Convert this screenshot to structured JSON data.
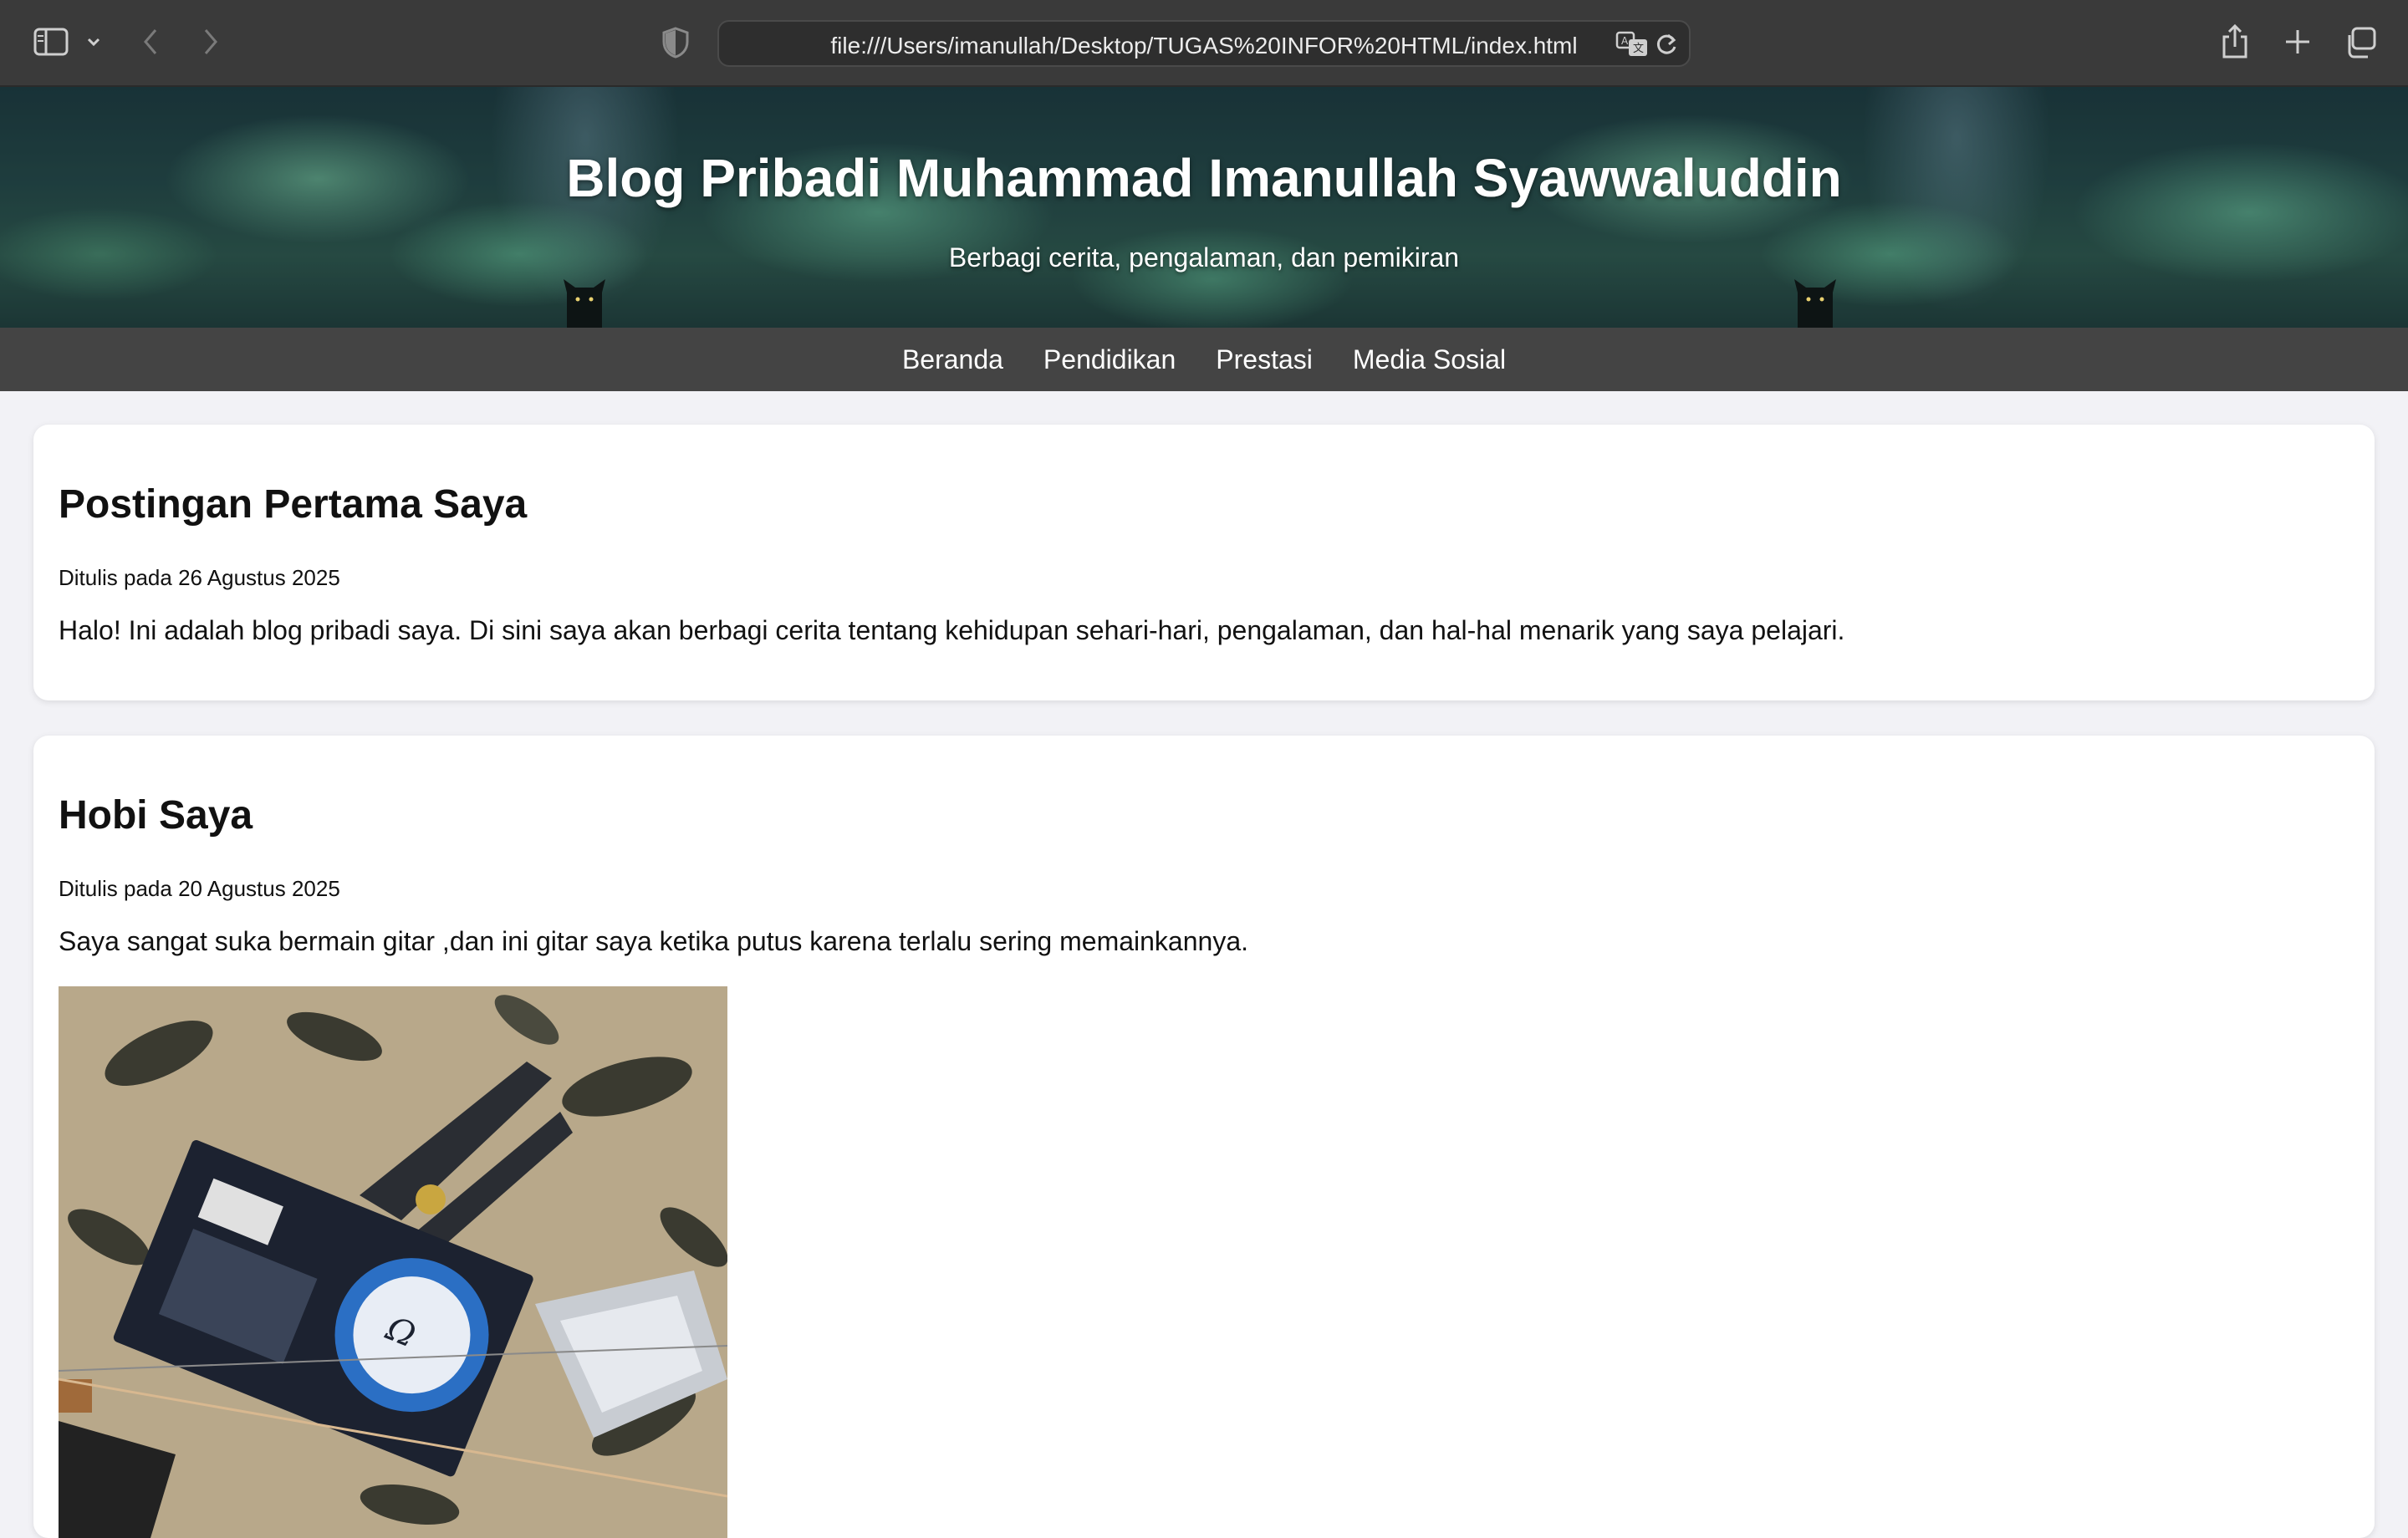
{
  "browser": {
    "url": "file:///Users/imanullah/Desktop/TUGAS%20INFOR%20HTML/index.html",
    "icons": [
      "sidebar-icon",
      "chevron-down-icon",
      "back-icon",
      "forward-icon",
      "shield-icon",
      "translate-icon",
      "reload-icon",
      "share-icon",
      "plus-icon",
      "tabs-icon"
    ]
  },
  "header": {
    "title": "Blog Pribadi Muhammad Imanullah Syawwaluddin",
    "subtitle": "Berbagi cerita, pengalaman, dan pemikiran"
  },
  "nav": {
    "items": [
      {
        "label": "Beranda"
      },
      {
        "label": "Pendidikan"
      },
      {
        "label": "Prestasi"
      },
      {
        "label": "Media Sosial"
      }
    ]
  },
  "posts": [
    {
      "title": "Postingan Pertama Saya",
      "meta": "Ditulis pada 26 Agustus 2025",
      "body": "Halo! Ini adalah blog pribadi saya. Di sini saya akan berbagi cerita tentang kehidupan sehari-hari, pengalaman, dan hal-hal menarik yang saya pelajari."
    },
    {
      "title": "Hobi Saya",
      "meta": "Ditulis pada 20 Agustus 2025",
      "body": "Saya sangat suka bermain gitar ,dan ini gitar saya ketika putus karena terlalu sering memainkannya."
    }
  ],
  "colors": {
    "toolbar": "#3a3a3a",
    "nav": "#444444",
    "page_bg": "#f2f2f6",
    "card_bg": "#ffffff"
  }
}
